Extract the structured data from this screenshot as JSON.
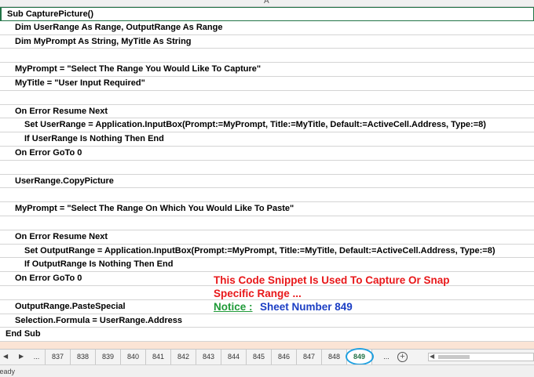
{
  "sheet": {
    "column_label": "A"
  },
  "code_lines": [
    "Sub CapturePicture()",
    "Dim UserRange As Range, OutputRange As Range",
    "Dim MyPrompt As String, MyTitle As String",
    "",
    "MyPrompt = \"Select The Range You Would Like To Capture\"",
    "MyTitle = \"User Input Required\"",
    "",
    "On Error Resume Next",
    "Set UserRange = Application.InputBox(Prompt:=MyPrompt, Title:=MyTitle, Default:=ActiveCell.Address, Type:=8)",
    "If UserRange Is Nothing Then End",
    "On Error GoTo 0",
    "",
    "UserRange.CopyPicture",
    "",
    "MyPrompt = \"Select The Range On Which You Would Like To Paste\"",
    "",
    "On Error Resume Next",
    "Set OutputRange = Application.InputBox(Prompt:=MyPrompt, Title:=MyTitle, Default:=ActiveCell.Address, Type:=8)",
    "If OutputRange Is Nothing Then End",
    "On Error GoTo 0",
    "",
    "OutputRange.PasteSpecial",
    "Selection.Formula = UserRange.Address",
    "End Sub",
    ""
  ],
  "annotation": {
    "line1": "This Code Snippet Is Used To Capture Or Snap",
    "line2": "Specific Range ...",
    "notice_label": "Notice :",
    "notice_text": "Sheet Number 849"
  },
  "tabs": {
    "ellipsis": "...",
    "items": [
      "837",
      "838",
      "839",
      "840",
      "841",
      "842",
      "843",
      "844",
      "845",
      "846",
      "847",
      "848",
      "849"
    ],
    "selected": "849",
    "more": "...",
    "add_icon": "plus-circle-icon",
    "prev_icon": "triangle-left-icon",
    "next_icon": "triangle-right-icon"
  },
  "status": {
    "text": "Ready"
  },
  "colors": {
    "accent": "#217346",
    "annotation_red": "#e8181a",
    "notice_green": "#1f9a38",
    "annotation_blue": "#1b3ec4",
    "highlight_circle": "#1ea0e0"
  }
}
